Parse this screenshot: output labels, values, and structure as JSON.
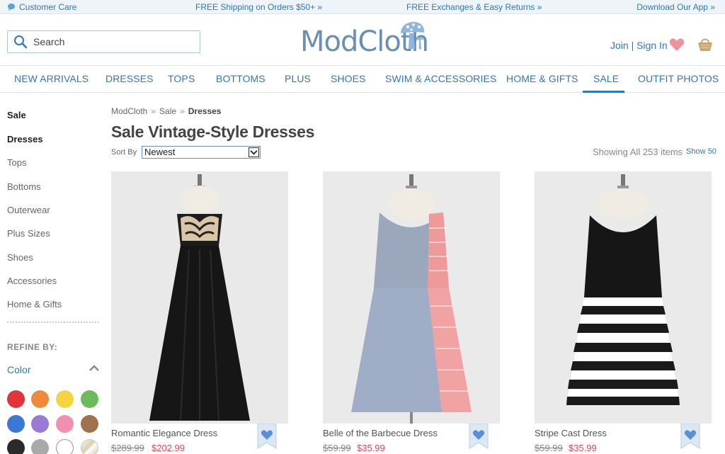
{
  "promo": {
    "customer_care": "Customer Care",
    "shipping": "FREE Shipping on Orders $50+ »",
    "exchanges": "FREE Exchanges & Easy Returns »",
    "app": "Download Our App »"
  },
  "header": {
    "search_placeholder": "Search",
    "logo_text": "ModCloth",
    "account_link": "Join | Sign In",
    "heart_color": "#f0929e",
    "basket_color": "#c9a774"
  },
  "nav": {
    "items": [
      {
        "label": "NEW ARRIVALS"
      },
      {
        "label": "DRESSES"
      },
      {
        "label": "TOPS"
      },
      {
        "label": "BOTTOMS"
      },
      {
        "label": "PLUS"
      },
      {
        "label": "SHOES"
      },
      {
        "label": "SWIM & ACCESSORIES"
      },
      {
        "label": "HOME & GIFTS"
      },
      {
        "label": "SALE"
      },
      {
        "label": "OUTFIT PHOTOS"
      }
    ],
    "active": "SALE"
  },
  "sidebar": {
    "items": [
      {
        "label": "Sale"
      },
      {
        "label": "Dresses"
      },
      {
        "label": "Tops"
      },
      {
        "label": "Bottoms"
      },
      {
        "label": "Outerwear"
      },
      {
        "label": "Plus Sizes"
      },
      {
        "label": "Shoes"
      },
      {
        "label": "Accessories"
      },
      {
        "label": "Home & Gifts"
      }
    ],
    "refine_label": "REFINE BY:",
    "color_label": "Color",
    "swatches": [
      "#e0363b",
      "#ef8a3a",
      "#f7d33e",
      "#6cbb5b",
      "#3d77d6",
      "#9b7ad6",
      "#f28fb0",
      "#a0714a",
      "#2b2b2b",
      "#a9a9a9",
      "#ffffff",
      "#e8e2d2"
    ]
  },
  "breadcrumb": {
    "items": [
      "ModCloth",
      "Sale",
      "Dresses"
    ],
    "separator": "»"
  },
  "page": {
    "title": "Sale Vintage-Style Dresses",
    "sort_label": "Sort By",
    "sort_value": "Newest",
    "showing": "Showing All 253 items",
    "show_per_page": "Show 50"
  },
  "products": [
    {
      "name": "Romantic Elegance Dress",
      "was": "$289.99",
      "now": "$202.99"
    },
    {
      "name": "Belle of the Barbecue Dress",
      "was": "$59.99",
      "now": "$35.99"
    },
    {
      "name": "Stripe Cast Dress",
      "was": "$59.99",
      "now": "$35.99"
    }
  ],
  "colors": {
    "brand_blue": "#2f78b8",
    "sale_red": "#e2495a",
    "logo_blue": "#6a8fb3"
  }
}
